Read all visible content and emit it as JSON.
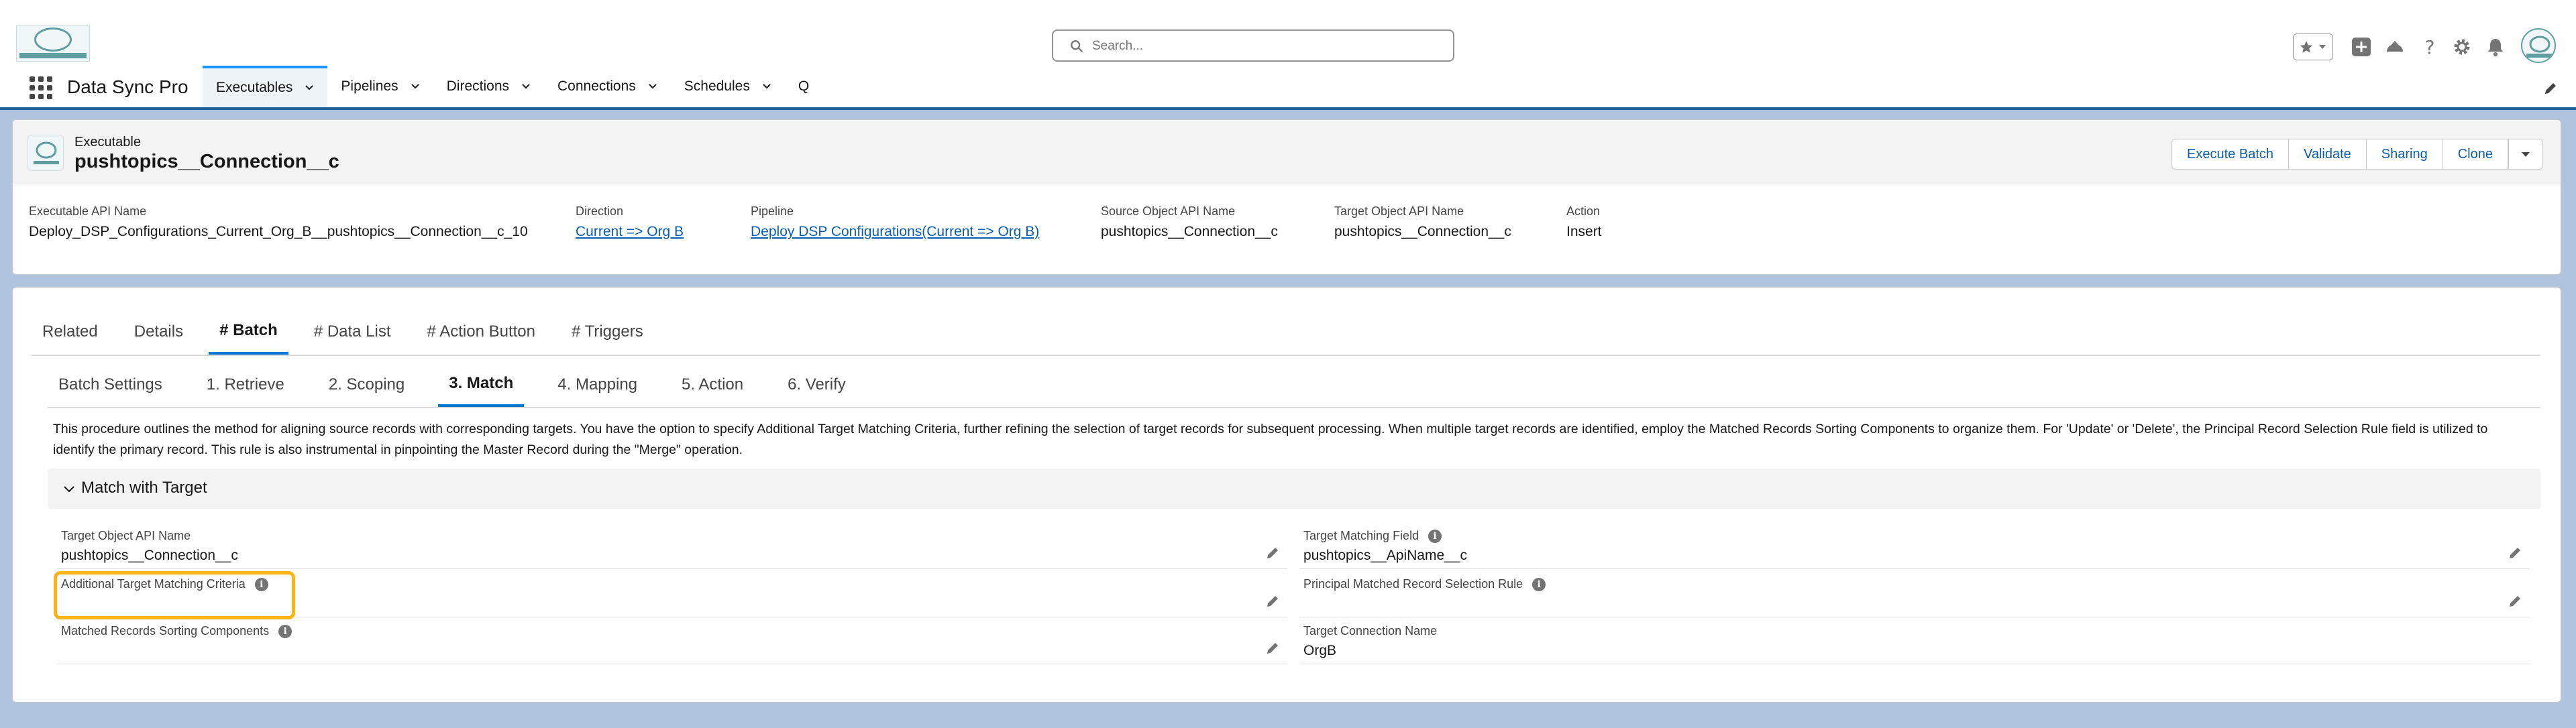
{
  "global_header": {
    "search_placeholder": "Search...",
    "icons": [
      "favorites-star-icon",
      "favorites-menu-icon",
      "add-icon",
      "trailhead-icon",
      "help-icon",
      "setup-gear-icon",
      "notifications-bell-icon",
      "avatar"
    ]
  },
  "nav": {
    "app_name": "Data Sync Pro",
    "items": [
      {
        "label": "Executables",
        "active": true
      },
      {
        "label": "Pipelines"
      },
      {
        "label": "Directions"
      },
      {
        "label": "Connections"
      },
      {
        "label": "Schedules"
      },
      {
        "label": "Q"
      }
    ]
  },
  "record": {
    "object_type": "Executable",
    "title": "pushtopics__Connection__c",
    "actions": [
      "Execute Batch",
      "Validate",
      "Sharing",
      "Clone"
    ],
    "fields": [
      {
        "label": "Executable API Name",
        "value": "Deploy_DSP_Configurations_Current_Org_B__pushtopics__Connection__c_10"
      },
      {
        "label": "Direction",
        "value": "Current => Org B",
        "link": true
      },
      {
        "label": "Pipeline",
        "value": "Deploy DSP Configurations(Current => Org B)",
        "link": true
      },
      {
        "label": "Source Object API Name",
        "value": "pushtopics__Connection__c"
      },
      {
        "label": "Target Object API Name",
        "value": "pushtopics__Connection__c"
      },
      {
        "label": "Action",
        "value": "Insert"
      }
    ]
  },
  "tabs": [
    "Related",
    "Details",
    "# Batch",
    "# Data List",
    "# Action Button",
    "# Triggers"
  ],
  "active_tab": "# Batch",
  "subtabs": [
    "Batch Settings",
    "1. Retrieve",
    "2. Scoping",
    "3. Match",
    "4. Mapping",
    "5. Action",
    "6. Verify"
  ],
  "active_subtab": "3. Match",
  "description": "This procedure outlines the method for aligning source records with corresponding targets. You have the option to specify Additional Target Matching Criteria, further refining the selection of target records for subsequent processing. When multiple target records are identified, employ the Matched Records Sorting Components to organize them. For 'Update' or 'Delete', the Principal Record Selection Rule field is utilized to identify the primary record. This rule is also instrumental in pinpointing the Master Record during the \"Merge\" operation.",
  "section": {
    "title": "Match with Target",
    "left_fields": [
      {
        "label": "Target Object API Name",
        "value": "pushtopics__Connection__c",
        "info": false
      },
      {
        "label": "Additional Target Matching Criteria",
        "value": "",
        "info": true
      },
      {
        "label": "Matched Records Sorting Components",
        "value": "",
        "info": true
      }
    ],
    "right_fields": [
      {
        "label": "Target Matching Field",
        "value": "pushtopics__ApiName__c",
        "info": true
      },
      {
        "label": "Principal Matched Record Selection Rule",
        "value": "",
        "info": true
      },
      {
        "label": "Target Connection Name",
        "value": "OrgB",
        "info": false
      }
    ]
  },
  "colors": {
    "brand_blue": "#0176d3",
    "link_blue": "#0b5cab",
    "highlight": "#fcb515",
    "background": "#b0c4df"
  }
}
